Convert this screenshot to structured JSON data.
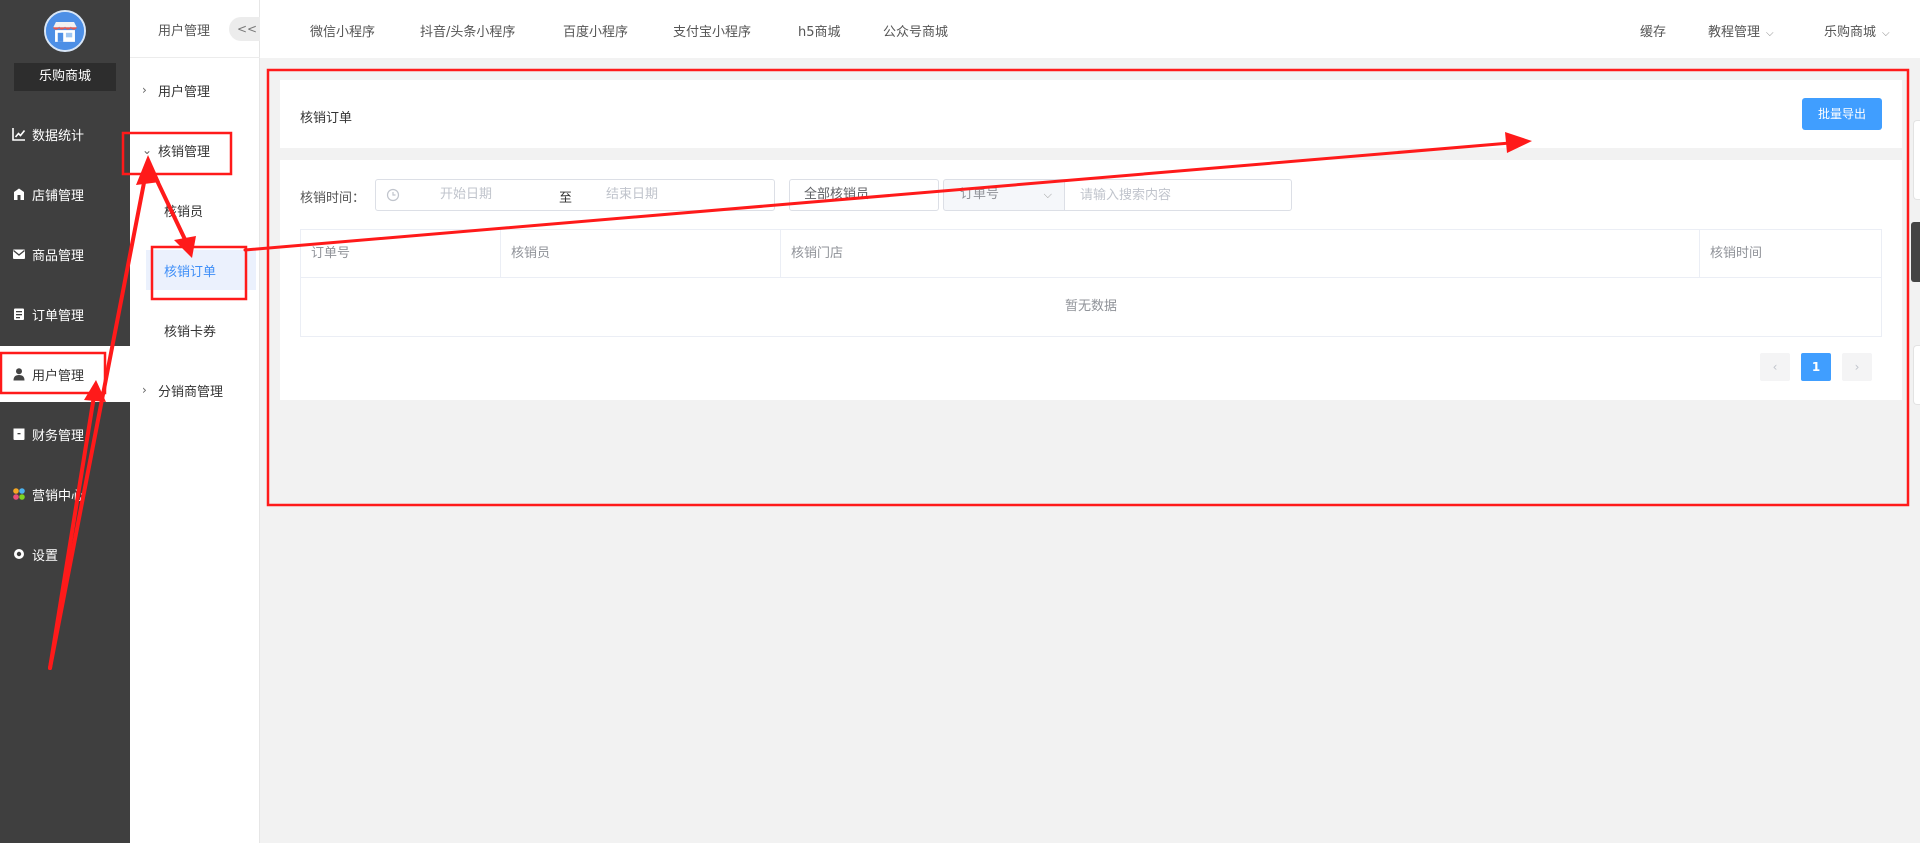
{
  "sidebar": {
    "brand": "乐购商城",
    "items": [
      {
        "label": "数据统计",
        "icon": "line-chart-icon"
      },
      {
        "label": "店铺管理",
        "icon": "store-icon"
      },
      {
        "label": "商品管理",
        "icon": "envelope-icon"
      },
      {
        "label": "订单管理",
        "icon": "clipboard-icon"
      },
      {
        "label": "用户管理",
        "icon": "user-icon",
        "active": true
      },
      {
        "label": "财务管理",
        "icon": "wallet-icon"
      },
      {
        "label": "营销中心",
        "icon": "puzzle-icon"
      },
      {
        "label": "设置",
        "icon": "gear-icon"
      }
    ]
  },
  "submenu": {
    "title": "用户管理",
    "collapse": "<<",
    "groups": [
      {
        "label": "用户管理",
        "expanded": false
      },
      {
        "label": "核销管理",
        "expanded": true
      },
      {
        "label": "分销商管理",
        "expanded": false
      }
    ],
    "items": [
      {
        "label": "核销员"
      },
      {
        "label": "核销订单",
        "active": true
      },
      {
        "label": "核销卡券"
      }
    ]
  },
  "header": {
    "tabs": [
      "微信小程序",
      "抖音/头条小程序",
      "百度小程序",
      "支付宝小程序",
      "h5商城",
      "公众号商城"
    ],
    "cache": "缓存",
    "tutorial": "教程管理",
    "mall": "乐购商城"
  },
  "page": {
    "title": "核销订单",
    "export_label": "批量导出"
  },
  "filters": {
    "time_label": "核销时间：",
    "start_placeholder": "开始日期",
    "range_sep": "至",
    "end_placeholder": "结束日期",
    "verifier": "全部核销员",
    "search_type": "订单号",
    "search_placeholder": "请输入搜索内容"
  },
  "table": {
    "columns": [
      "订单号",
      "核销员",
      "核销门店",
      "核销时间"
    ],
    "empty": "暂无数据"
  },
  "pagination": {
    "prev": "‹",
    "current": "1",
    "next": "›"
  },
  "colors": {
    "sidebar_bg": "#3f3f3f",
    "primary": "#409eff",
    "annotation": "#ff1a1a"
  }
}
